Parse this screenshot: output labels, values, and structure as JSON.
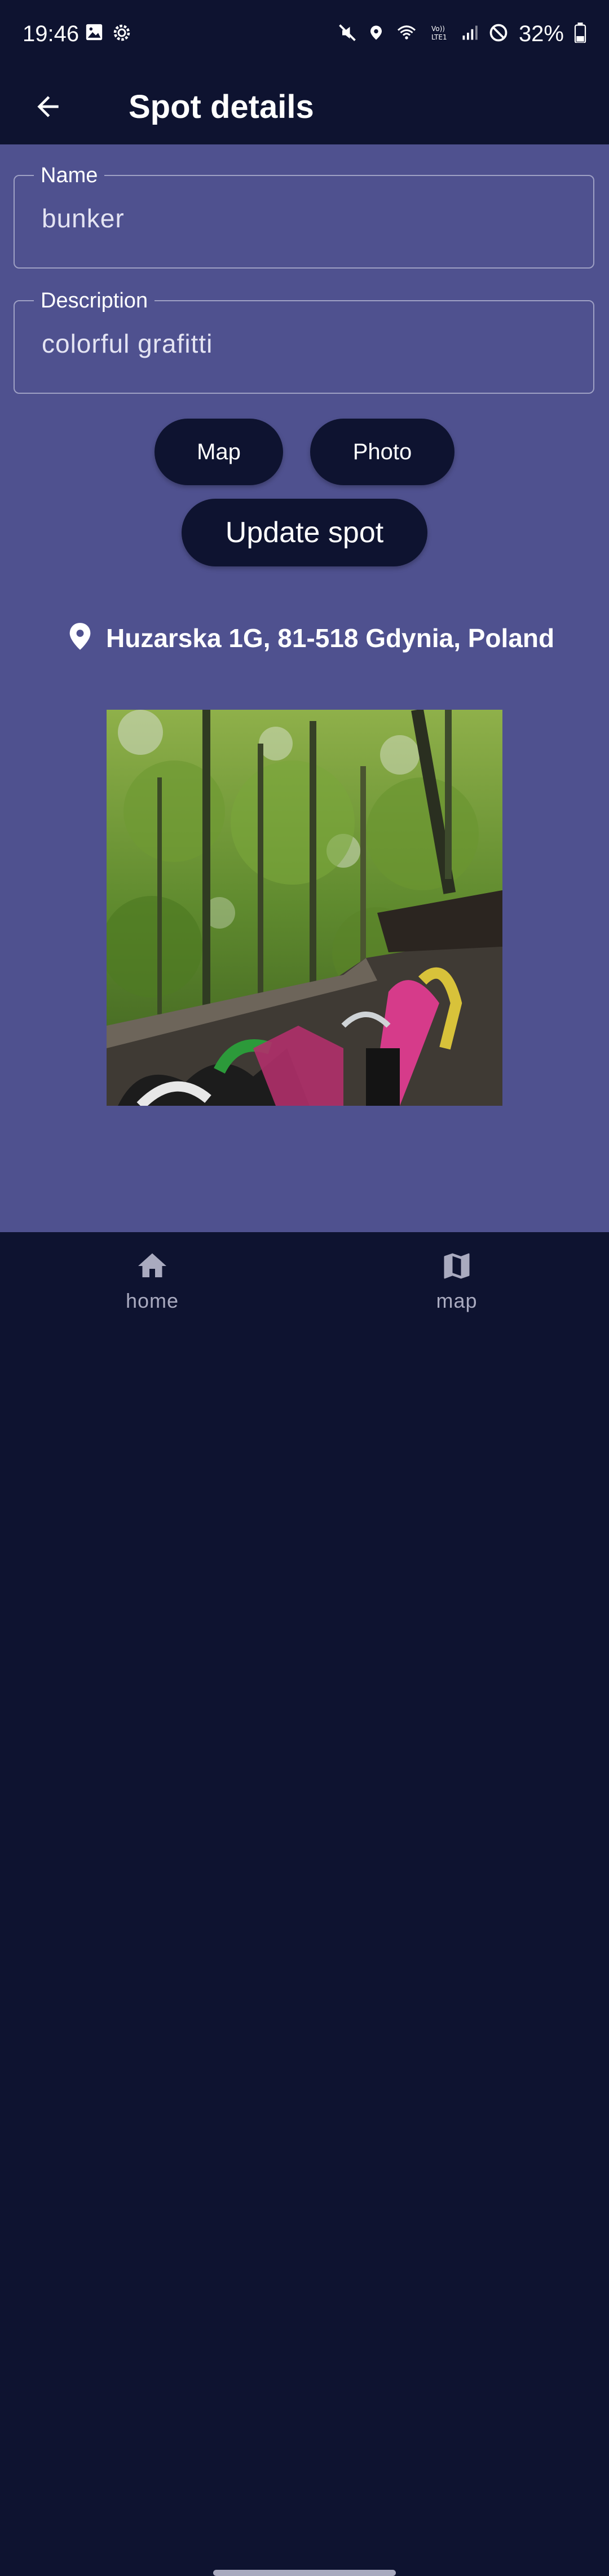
{
  "status_bar": {
    "time": "19:46",
    "battery_percent": "32%",
    "icons": [
      "image-icon",
      "settings-icon",
      "mute-icon",
      "location-icon",
      "wifi-icon",
      "volte-icon",
      "signal-icon",
      "dnd-icon",
      "battery-icon"
    ]
  },
  "app_bar": {
    "title": "Spot details",
    "back_icon": "arrow-back-icon"
  },
  "form": {
    "name": {
      "label": "Name",
      "value": "bunker"
    },
    "description": {
      "label": "Description",
      "value": "colorful grafitti"
    }
  },
  "buttons": {
    "map_label": "Map",
    "photo_label": "Photo",
    "update_label": "Update spot"
  },
  "location": {
    "icon": "location-pin-icon",
    "address": "Huzarska 1G, 81-518 Gdynia, Poland"
  },
  "photo": {
    "description_icon": "spot-photo"
  },
  "bottom_nav": {
    "items": [
      {
        "label": "home",
        "icon": "home-icon"
      },
      {
        "label": "map",
        "icon": "map-icon"
      }
    ]
  },
  "colors": {
    "dark_navy": "#0e1330",
    "content_purple": "#4f518f",
    "nav_label_gray": "#a9aabf",
    "white": "#ffffff"
  }
}
